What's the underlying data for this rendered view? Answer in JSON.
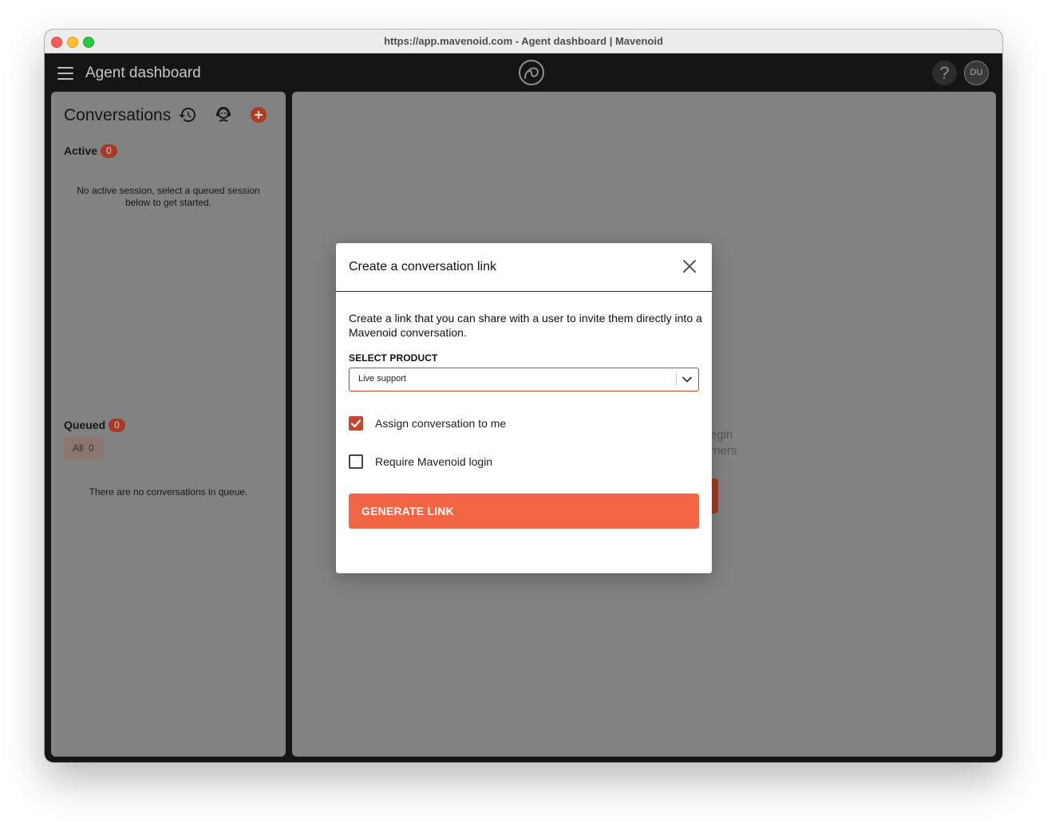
{
  "window": {
    "title": "https://app.mavenoid.com - Agent dashboard | Mavenoid"
  },
  "appbar": {
    "title": "Agent dashboard",
    "help_label": "?",
    "avatar_initials": "DU"
  },
  "sidebar": {
    "title": "Conversations",
    "active": {
      "label": "Active",
      "count": "0",
      "empty_text": "No active session, select a queued session below to get started."
    },
    "queued": {
      "label": "Queued",
      "count": "0",
      "filter_label": "All",
      "filter_count": "0",
      "empty_text": "There are no conversations in queue."
    }
  },
  "main_background": {
    "partial_line1": "egin",
    "partial_line2": "mers"
  },
  "modal": {
    "title": "Create a conversation link",
    "description": "Create a link that you can share with a user to invite them directly into a Mavenoid conversation.",
    "select_label": "SELECT PRODUCT",
    "select_value": "Live support",
    "assign_label": "Assign conversation to me",
    "assign_checked": true,
    "login_label": "Require Mavenoid login",
    "login_checked": false,
    "generate_label": "GENERATE LINK"
  },
  "colors": {
    "accent": "#f46543",
    "accent_dark": "#c2472c",
    "badge": "#a73a25",
    "panel": "#828282",
    "appbar": "#151515"
  },
  "icons": [
    "menu-icon",
    "mavenoid-logo-icon",
    "help-icon",
    "history-icon",
    "agent-icon",
    "add-icon",
    "close-icon",
    "chevron-down-icon",
    "check-icon"
  ]
}
